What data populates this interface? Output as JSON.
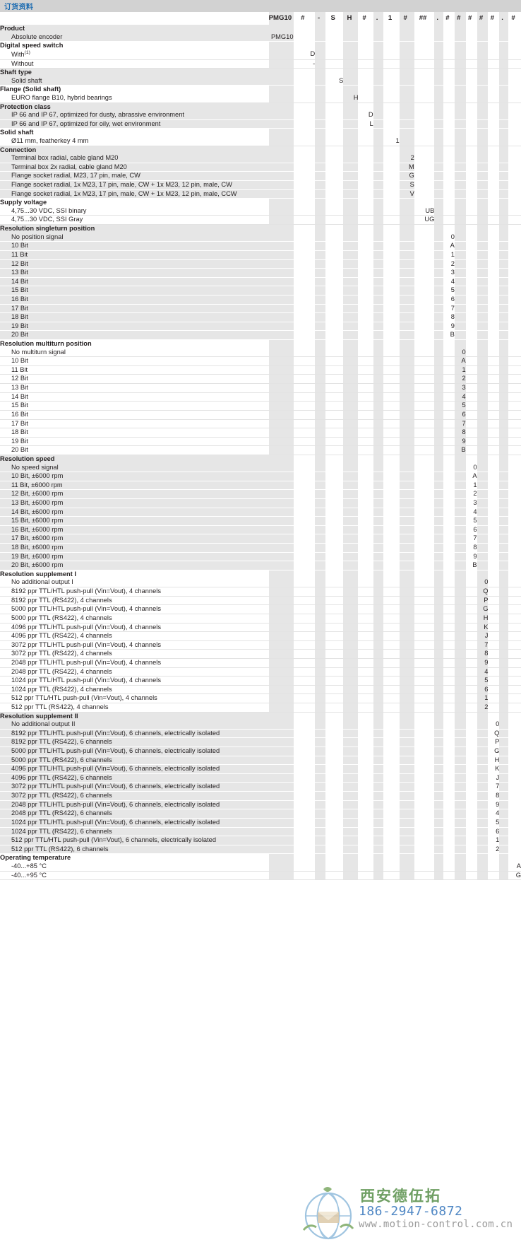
{
  "title": "订货资料",
  "header": {
    "label": "",
    "code_parts": [
      "PMG10",
      "#",
      "-",
      "S",
      "H",
      "#",
      ".",
      "1",
      "#",
      "##",
      ".",
      "#",
      "#",
      "#",
      "#",
      "#",
      ".",
      "#"
    ]
  },
  "columns": {
    "c_pmg": 0,
    "c_speed_switch": 1,
    "c_shaft_type": 3,
    "c_flange": 4,
    "c_protection": 5,
    "c_solid_shaft": 7,
    "c_connection": 8,
    "c_supply": 9,
    "c_singleturn": 11,
    "c_multiturn": 12,
    "c_speed": 13,
    "c_suppl1": 14,
    "c_suppl2": 15,
    "c_temp": 17
  },
  "sections": [
    {
      "heading": "Product",
      "col": 0,
      "band": "grey",
      "rows": [
        {
          "label": "Absolute encoder",
          "code": "PMG10"
        }
      ]
    },
    {
      "heading": "Digital speed switch",
      "col": 1,
      "band": "white",
      "rows": [
        {
          "label": "With",
          "sup": "(1)",
          "code": "D"
        },
        {
          "label": "Without",
          "code": "-"
        }
      ]
    },
    {
      "heading": "Shaft type",
      "col": 3,
      "band": "grey",
      "rows": [
        {
          "label": "Solid shaft",
          "code": "S"
        }
      ]
    },
    {
      "heading": "Flange (Solid shaft)",
      "col": 4,
      "band": "white",
      "rows": [
        {
          "label": "EURO flange B10, hybrid bearings",
          "code": "H"
        }
      ]
    },
    {
      "heading": "Protection class",
      "col": 5,
      "band": "grey",
      "rows": [
        {
          "label": "IP 66 and IP 67, optimized for dusty, abrassive environment",
          "code": "D"
        },
        {
          "label": "IP 66 and IP 67, optimized for oily, wet environment",
          "code": "L"
        }
      ]
    },
    {
      "heading": "Solid shaft",
      "col": 7,
      "band": "white",
      "rows": [
        {
          "label": "Ø11 mm, featherkey 4 mm",
          "code": "1"
        }
      ]
    },
    {
      "heading": "Connection",
      "col": 8,
      "band": "grey",
      "rows": [
        {
          "label": "Terminal box radial, cable gland M20",
          "code": "2"
        },
        {
          "label": "Terminal box 2x radial, cable gland M20",
          "code": "M"
        },
        {
          "label": "Flange socket radial, M23, 17 pin, male, CW",
          "code": "G"
        },
        {
          "label": "Flange socket radial, 1x M23, 17 pin, male, CW + 1x M23, 12 pin, male, CW",
          "code": "S"
        },
        {
          "label": "Flange socket radial, 1x M23, 17 pin, male, CW + 1x M23, 12 pin, male, CCW",
          "code": "V"
        }
      ]
    },
    {
      "heading": "Supply voltage",
      "col": 9,
      "band": "white",
      "rows": [
        {
          "label": "4,75...30 VDC, SSI binary",
          "code": "UB"
        },
        {
          "label": "4,75...30 VDC, SSI Gray",
          "code": "UG"
        }
      ]
    },
    {
      "heading": "Resolution singleturn position",
      "col": 11,
      "band": "grey",
      "rows": [
        {
          "label": "No position signal",
          "code": "0"
        },
        {
          "label": "10 Bit",
          "code": "A"
        },
        {
          "label": "11 Bit",
          "code": "1"
        },
        {
          "label": "12 Bit",
          "code": "2"
        },
        {
          "label": "13 Bit",
          "code": "3"
        },
        {
          "label": "14 Bit",
          "code": "4"
        },
        {
          "label": "15 Bit",
          "code": "5"
        },
        {
          "label": "16 Bit",
          "code": "6"
        },
        {
          "label": "17 Bit",
          "code": "7"
        },
        {
          "label": "18 Bit",
          "code": "8"
        },
        {
          "label": "19 Bit",
          "code": "9"
        },
        {
          "label": "20 Bit",
          "code": "B"
        }
      ]
    },
    {
      "heading": "Resolution multiturn position",
      "col": 12,
      "band": "white",
      "rows": [
        {
          "label": "No multiturn signal",
          "code": "0"
        },
        {
          "label": "10 Bit",
          "code": "A"
        },
        {
          "label": "11 Bit",
          "code": "1"
        },
        {
          "label": "12 Bit",
          "code": "2"
        },
        {
          "label": "13 Bit",
          "code": "3"
        },
        {
          "label": "14 Bit",
          "code": "4"
        },
        {
          "label": "15 Bit",
          "code": "5"
        },
        {
          "label": "16 Bit",
          "code": "6"
        },
        {
          "label": "17 Bit",
          "code": "7"
        },
        {
          "label": "18 Bit",
          "code": "8"
        },
        {
          "label": "19 Bit",
          "code": "9"
        },
        {
          "label": "20 Bit",
          "code": "B"
        }
      ]
    },
    {
      "heading": "Resolution speed",
      "col": 13,
      "band": "grey",
      "rows": [
        {
          "label": "No speed signal",
          "code": "0"
        },
        {
          "label": "10 Bit, ±6000 rpm",
          "code": "A"
        },
        {
          "label": "11 Bit, ±6000 rpm",
          "code": "1"
        },
        {
          "label": "12 Bit, ±6000 rpm",
          "code": "2"
        },
        {
          "label": "13 Bit, ±6000 rpm",
          "code": "3"
        },
        {
          "label": "14 Bit, ±6000 rpm",
          "code": "4"
        },
        {
          "label": "15 Bit, ±6000 rpm",
          "code": "5"
        },
        {
          "label": "16 Bit, ±6000 rpm",
          "code": "6"
        },
        {
          "label": "17 Bit, ±6000 rpm",
          "code": "7"
        },
        {
          "label": "18 Bit, ±6000 rpm",
          "code": "8"
        },
        {
          "label": "19 Bit, ±6000 rpm",
          "code": "9"
        },
        {
          "label": "20 Bit, ±6000 rpm",
          "code": "B"
        }
      ]
    },
    {
      "heading": "Resolution supplement I",
      "col": 14,
      "band": "white",
      "rows": [
        {
          "label": "No additional output I",
          "code": "0"
        },
        {
          "label": "8192 ppr TTL/HTL push-pull (Vin=Vout), 4 channels",
          "code": "Q"
        },
        {
          "label": "8192 ppr TTL (RS422), 4 channels",
          "code": "P"
        },
        {
          "label": "5000 ppr TTL/HTL push-pull (Vin=Vout), 4 channels",
          "code": "G"
        },
        {
          "label": "5000 ppr TTL (RS422), 4 channels",
          "code": "H"
        },
        {
          "label": "4096 ppr TTL/HTL push-pull (Vin=Vout), 4 channels",
          "code": "K"
        },
        {
          "label": "4096 ppr TTL (RS422), 4 channels",
          "code": "J"
        },
        {
          "label": "3072 ppr TTL/HTL push-pull (Vin=Vout), 4 channels",
          "code": "7"
        },
        {
          "label": "3072 ppr TTL (RS422), 4 channels",
          "code": "8"
        },
        {
          "label": "2048 ppr TTL/HTL push-pull (Vin=Vout), 4 channels",
          "code": "9"
        },
        {
          "label": "2048 ppr TTL (RS422), 4 channels",
          "code": "4"
        },
        {
          "label": "1024 ppr TTL/HTL push-pull (Vin=Vout), 4 channels",
          "code": "5"
        },
        {
          "label": "1024 ppr TTL (RS422), 4 channels",
          "code": "6"
        },
        {
          "label": "512 ppr TTL/HTL push-pull (Vin=Vout), 4 channels",
          "code": "1"
        },
        {
          "label": "512 ppr TTL (RS422), 4 channels",
          "code": "2"
        }
      ]
    },
    {
      "heading": "Resolution supplement II",
      "col": 15,
      "band": "grey",
      "rows": [
        {
          "label": "No additional output II",
          "code": "0"
        },
        {
          "label": "8192 ppr TTL/HTL push-pull (Vin=Vout), 6 channels, electrically isolated",
          "code": "Q"
        },
        {
          "label": "8192 ppr TTL (RS422), 6 channels",
          "code": "P"
        },
        {
          "label": "5000 ppr TTL/HTL push-pull (Vin=Vout), 6 channels, electrically isolated",
          "code": "G"
        },
        {
          "label": "5000 ppr TTL (RS422), 6 channels",
          "code": "H"
        },
        {
          "label": "4096 ppr TTL/HTL push-pull (Vin=Vout), 6 channels, electrically isolated",
          "code": "K"
        },
        {
          "label": "4096 ppr TTL (RS422), 6 channels",
          "code": "J"
        },
        {
          "label": "3072 ppr TTL/HTL push-pull (Vin=Vout), 6 channels, electrically isolated",
          "code": "7"
        },
        {
          "label": "3072 ppr TTL (RS422), 6 channels",
          "code": "8"
        },
        {
          "label": "2048 ppr TTL/HTL push-pull (Vin=Vout), 6 channels, electrically isolated",
          "code": "9"
        },
        {
          "label": "2048 ppr TTL (RS422), 6 channels",
          "code": "4"
        },
        {
          "label": "1024 ppr TTL/HTL push-pull (Vin=Vout), 6 channels, electrically isolated",
          "code": "5"
        },
        {
          "label": "1024 ppr TTL (RS422), 6 channels",
          "code": "6"
        },
        {
          "label": "512 ppr TTL/HTL push-pull (Vin=Vout), 6 channels, electrically isolated",
          "code": "1"
        },
        {
          "label": "512 ppr TTL (RS422), 6 channels",
          "code": "2"
        }
      ]
    },
    {
      "heading": "Operating temperature",
      "col": 17,
      "band": "white",
      "rows": [
        {
          "label": "-40...+85 °C",
          "code": "A"
        },
        {
          "label": "-40...+95 °C",
          "code": "G"
        }
      ]
    }
  ],
  "watermark": {
    "company": "西安德伍拓",
    "phone": "186-2947-6872",
    "url": "www.motion-control.com.cn"
  },
  "colors": {
    "title_text": "#1a6ab0",
    "title_band": "#d2d2d2",
    "band_grey": "#e6e6e6",
    "band_white": "#ffffff",
    "text": "#231f20",
    "wm_green": "#6f9f63",
    "wm_blue": "#4f87c4",
    "wm_grey": "#9a9a9a"
  }
}
